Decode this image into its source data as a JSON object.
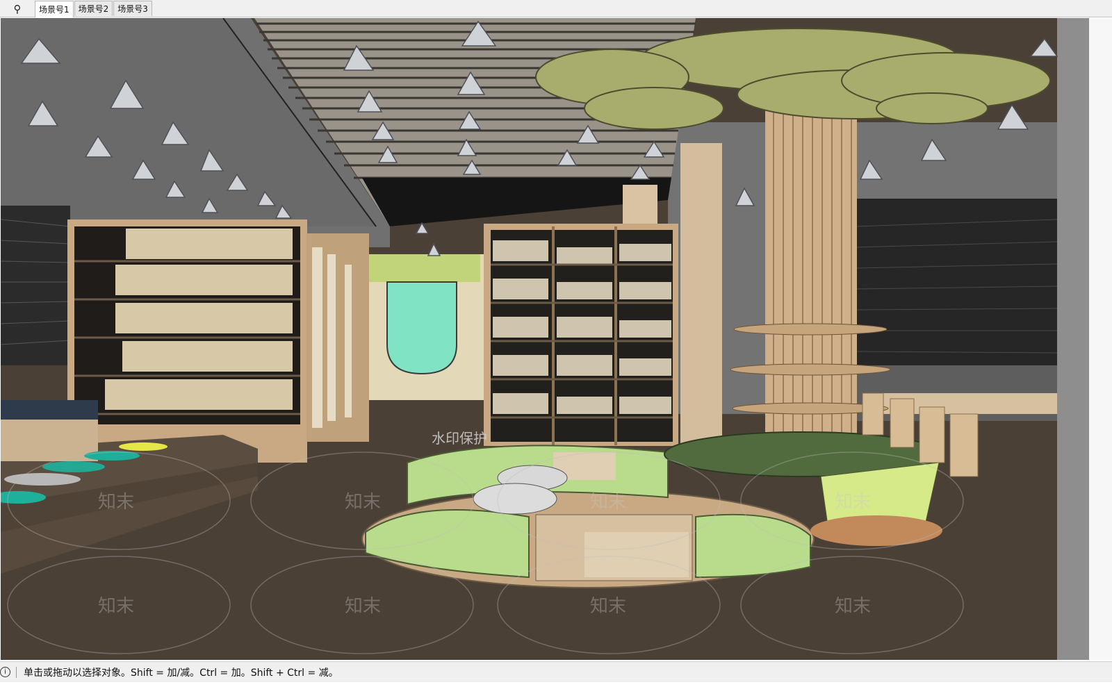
{
  "toolbar": {
    "search_icon": "search-icon"
  },
  "tabs": [
    {
      "label": "场景号1",
      "active": true
    },
    {
      "label": "场景号2",
      "active": false
    },
    {
      "label": "场景号3",
      "active": false
    }
  ],
  "viewport": {
    "watermark_banner": "水印保护",
    "watermark_logo": "知末"
  },
  "statusbar": {
    "info_icon": "info-icon",
    "message": "单击或拖动以选择对象。Shift = 加/减。Ctrl = 加。Shift + Ctrl = 减。"
  },
  "colors": {
    "floor": "#4b4036",
    "wall_gray": "#6d6d6d",
    "ceiling_gray": "#8a8a8a",
    "wood": "#d8bd96",
    "tree_green": "#a5ad6a",
    "seat_green": "#b9dc8c",
    "mint": "#7fe3c4"
  }
}
